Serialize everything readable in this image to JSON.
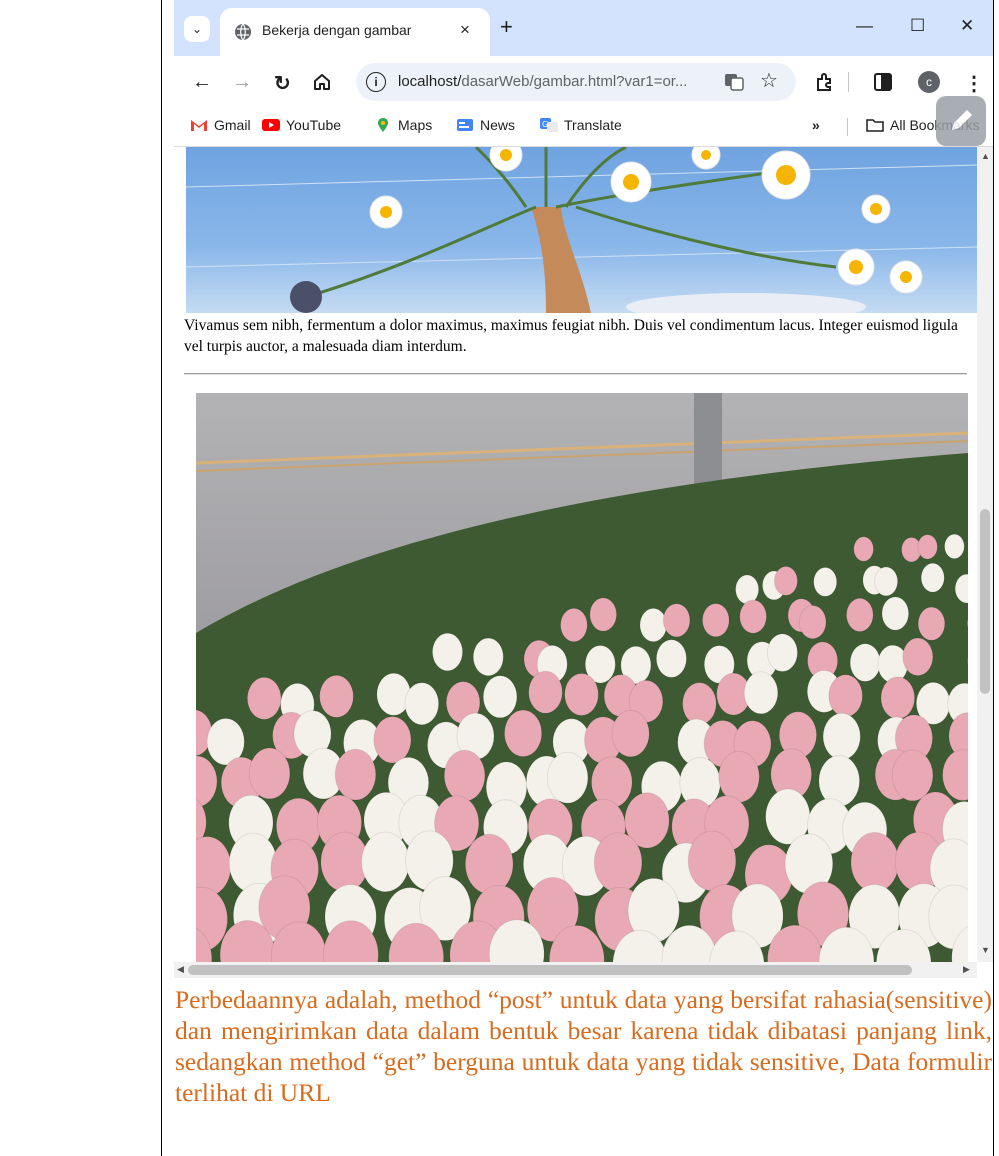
{
  "browser": {
    "tab_title": "Bekerja dengan gambar",
    "tab_close": "×",
    "new_tab": "+",
    "window_controls": {
      "minimize": "—",
      "maximize": "☐",
      "close": "✕"
    },
    "url_host": "localhost/",
    "url_path": "dasarWeb/gambar.html?var1=or...",
    "bookmarks": [
      {
        "label": "Gmail",
        "icon": "gmail-icon",
        "color": "#ea4335"
      },
      {
        "label": "YouTube",
        "icon": "youtube-icon",
        "color": "#ff0000"
      },
      {
        "label": "Maps",
        "icon": "maps-icon",
        "color": "#34a853"
      },
      {
        "label": "News",
        "icon": "news-icon",
        "color": "#4285f4"
      },
      {
        "label": "Translate",
        "icon": "translate-icon",
        "color": "#4285f4"
      }
    ],
    "bookmarks_overflow": "»",
    "all_bookmarks": "All Bookmarks",
    "profile_initial": "c"
  },
  "page": {
    "paragraph": "Vivamus sem nibh, fermentum a dolor maximus, maximus feugiat nibh. Duis vel condimentum lacus. Integer euismod ligula vel turpis auctor, a malesuada diam interdum."
  },
  "document": {
    "answer_text": "Perbedaannya adalah, method “post” untuk data yang bersifat rahasia(sensitive) dan mengirimkan data dalam bentuk besar karena tidak dibatasi panjang link, sedangkan method “get” berguna untuk data yang tidak sensitive, Data formulir terlihat di URL",
    "answer_color": "#d86b1e"
  }
}
